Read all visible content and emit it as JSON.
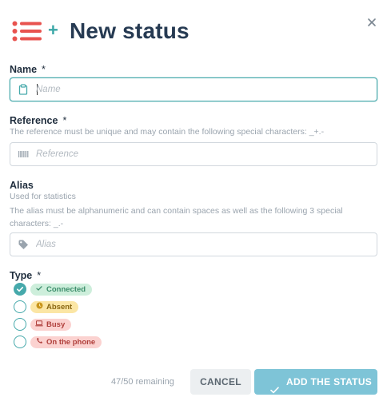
{
  "header": {
    "title": "New status",
    "plus": "+",
    "icon": "list-icon",
    "close_icon": "close-icon"
  },
  "name": {
    "label": "Name",
    "required": "*",
    "placeholder": "Name",
    "value": "",
    "icon": "clipboard-icon"
  },
  "reference": {
    "label": "Reference",
    "required": "*",
    "help": "The reference must be unique and may contain the following special characters: _+.-",
    "placeholder": "Reference",
    "value": "",
    "icon": "barcode-icon"
  },
  "alias": {
    "label": "Alias",
    "help1": "Used for statistics",
    "help2": "The alias must be alphanumeric and can contain spaces as well as the following 3 special characters: _.-",
    "placeholder": "Alias",
    "value": "",
    "icon": "tag-icon"
  },
  "type": {
    "label": "Type",
    "required": "*",
    "options": [
      {
        "label": "Connected",
        "icon": "check-icon",
        "checked": true
      },
      {
        "label": "Absent",
        "icon": "clock-icon",
        "checked": false
      },
      {
        "label": "Busy",
        "icon": "laptop-icon",
        "checked": false
      },
      {
        "label": "On the phone",
        "icon": "phone-icon",
        "checked": false
      }
    ]
  },
  "footer": {
    "remaining": "47/50 remaining",
    "cancel_label": "CANCEL",
    "add_label": "ADD THE STATUS"
  },
  "colors": {
    "accent": "#46a9ab",
    "title": "#263a52",
    "header_icon": "#e8534f",
    "primary_button": "#7ec4d7"
  }
}
